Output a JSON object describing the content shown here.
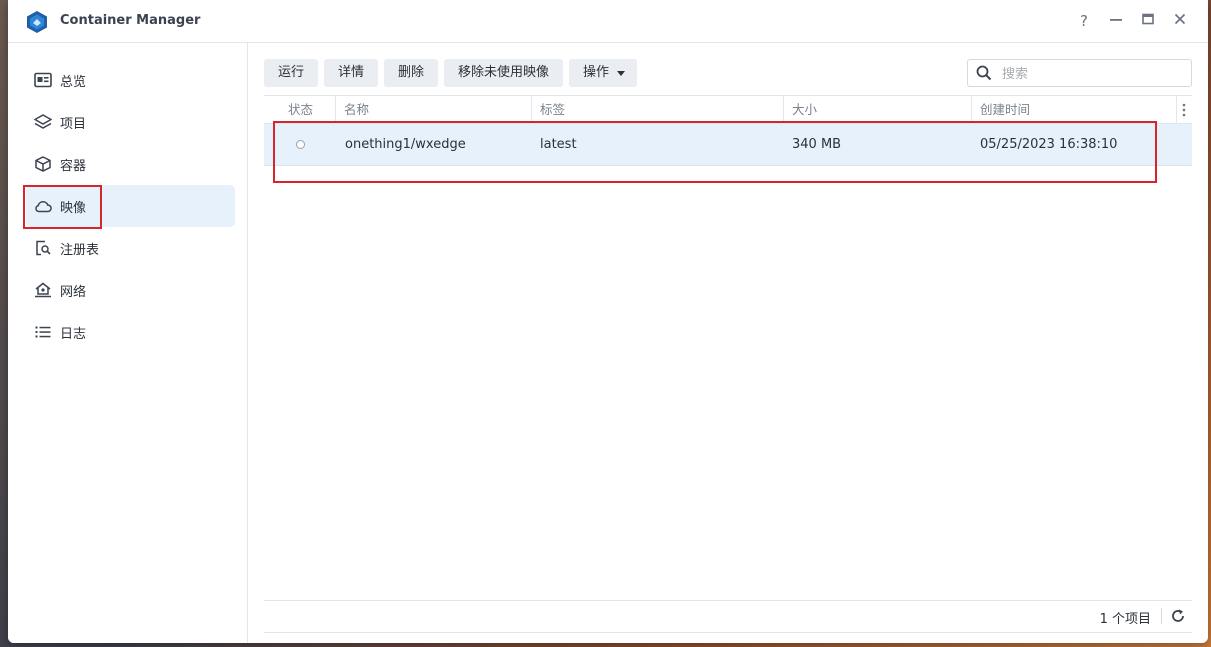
{
  "window": {
    "title": "Container Manager",
    "controls": {
      "help": "?",
      "minimize": "—",
      "maximize": "▭",
      "close": "✕"
    }
  },
  "sidebar": {
    "items": [
      {
        "label": "总览",
        "icon": "overview-icon"
      },
      {
        "label": "项目",
        "icon": "layers-icon"
      },
      {
        "label": "容器",
        "icon": "cube-icon"
      },
      {
        "label": "映像",
        "icon": "cloud-icon",
        "active": true
      },
      {
        "label": "注册表",
        "icon": "registry-search-icon"
      },
      {
        "label": "网络",
        "icon": "network-home-icon"
      },
      {
        "label": "日志",
        "icon": "list-icon"
      }
    ]
  },
  "toolbar": {
    "run": "运行",
    "details": "详情",
    "delete": "删除",
    "remove_unused": "移除未使用映像",
    "actions": "操作"
  },
  "search": {
    "placeholder": "搜索",
    "value": ""
  },
  "table": {
    "columns": [
      "状态",
      "名称",
      "标签",
      "大小",
      "创建时间"
    ],
    "rows": [
      {
        "status": "stopped",
        "name": "onething1/wxedge",
        "tag": "latest",
        "size": "340 MB",
        "created": "05/25/2023 16:38:10"
      }
    ]
  },
  "footer": {
    "count": "1 个项目"
  },
  "colors": {
    "accent": "#e6f1fc",
    "highlight": "#d7262b"
  }
}
